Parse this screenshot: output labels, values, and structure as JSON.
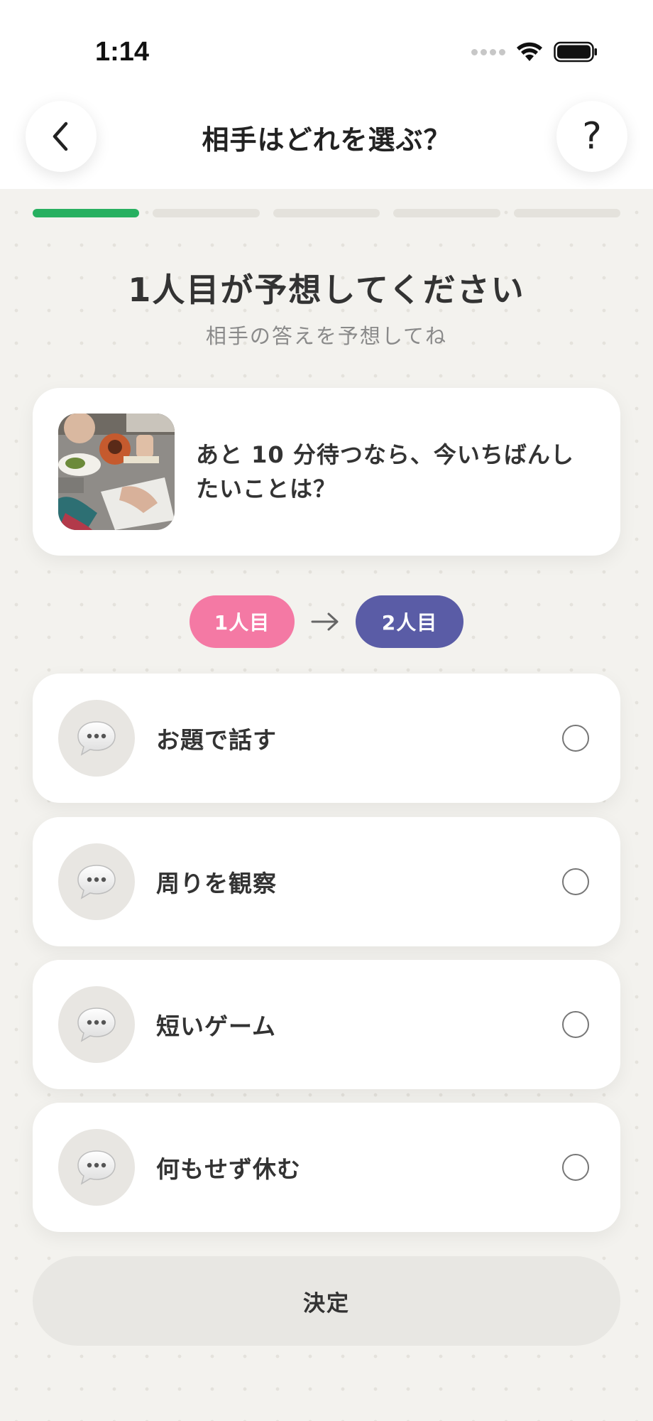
{
  "status_bar": {
    "time": "1:14"
  },
  "header": {
    "title": "相手はどれを選ぶ？",
    "help_label": "?"
  },
  "progress": {
    "total_steps": 5,
    "current_step": 1
  },
  "heading": {
    "title": "1人目が予想してください",
    "subtitle": "相手の答えを予想してね"
  },
  "question": {
    "text": "あと 10 分待つなら、今いちばんしたいことは？"
  },
  "turn": {
    "first": "1人目",
    "second": "2人目"
  },
  "options": [
    {
      "label": "お題で話す",
      "icon": "speech-bubble-icon",
      "selected": false
    },
    {
      "label": "周りを観察",
      "icon": "speech-bubble-icon",
      "selected": false
    },
    {
      "label": "短いゲーム",
      "icon": "speech-bubble-icon",
      "selected": false
    },
    {
      "label": "何もせず休む",
      "icon": "speech-bubble-icon",
      "selected": false
    }
  ],
  "decide_button": {
    "label": "決定"
  },
  "colors": {
    "progress_active": "#27b060",
    "progress_inactive": "#e4e2dc",
    "player1": "#f479a4",
    "player2": "#5a5ca6",
    "background": "#f3f2ee"
  }
}
